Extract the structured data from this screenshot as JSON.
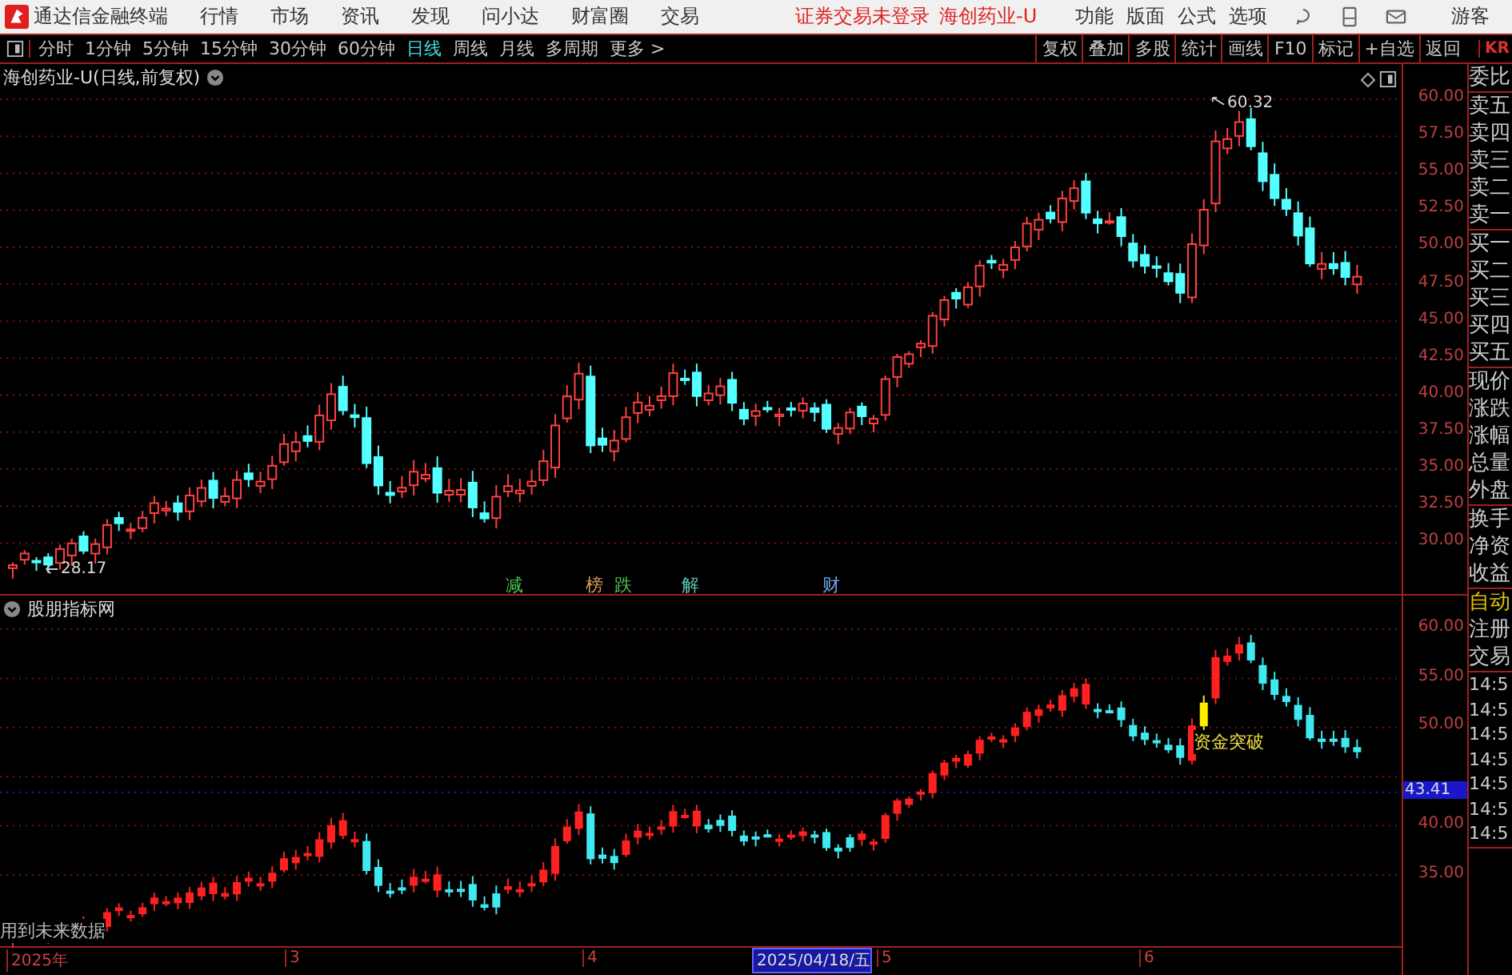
{
  "app": {
    "title": "通达信金融终端",
    "menu": [
      "行情",
      "市场",
      "资讯",
      "发现",
      "问小达",
      "财富圈",
      "交易"
    ],
    "login_status": "证券交易未登录",
    "stock": "海创药业-U",
    "right_menu": [
      "功能",
      "版面",
      "公式",
      "选项"
    ],
    "user": "游客"
  },
  "periods": [
    {
      "label": "分时",
      "selected": false
    },
    {
      "label": "1分钟",
      "selected": false
    },
    {
      "label": "5分钟",
      "selected": false
    },
    {
      "label": "15分钟",
      "selected": false
    },
    {
      "label": "30分钟",
      "selected": false
    },
    {
      "label": "60分钟",
      "selected": false
    },
    {
      "label": "日线",
      "selected": true
    },
    {
      "label": "周线",
      "selected": false
    },
    {
      "label": "月线",
      "selected": false
    },
    {
      "label": "多周期",
      "selected": false
    },
    {
      "label": "更多 >",
      "selected": false
    }
  ],
  "toolbar": [
    "复权",
    "叠加",
    "多股",
    "统计",
    "画线",
    "F10",
    "标记",
    "+自选",
    "返回"
  ],
  "toolbar_cut": "KR",
  "main_chart": {
    "title": "海创药业-U(日线,前复权)",
    "yticks": [
      "60.00",
      "57.50",
      "55.00",
      "52.50",
      "50.00",
      "47.50",
      "45.00",
      "42.50",
      "40.00",
      "37.50",
      "35.00",
      "32.50",
      "30.00"
    ],
    "high_label": "60.32",
    "low_label": "28.17",
    "events": [
      {
        "label": "减",
        "color": "#4cc24c"
      },
      {
        "label": "榜",
        "color": "#d89a5a"
      },
      {
        "label": "跌",
        "color": "#4cc24c"
      },
      {
        "label": "解",
        "color": "#5ac8b0"
      },
      {
        "label": "财",
        "color": "#6aa8e8"
      }
    ]
  },
  "indicator": {
    "title": "股朋指标网",
    "yticks": [
      "60.00",
      "55.00",
      "50.00",
      "40.00",
      "35.00"
    ],
    "current": "43.41",
    "signal": "资金突破",
    "note": "用到未来数据"
  },
  "time_axis": [
    {
      "label": "2025年",
      "selected": false
    },
    {
      "label": "3",
      "selected": false
    },
    {
      "label": "4",
      "selected": false
    },
    {
      "label": "2025/04/18/五",
      "selected": true
    },
    {
      "label": "5",
      "selected": false
    },
    {
      "label": "6",
      "selected": false
    }
  ],
  "side_panel": {
    "quote_groups": [
      [
        "委比"
      ],
      [
        "卖五",
        "卖四",
        "卖三",
        "卖二",
        "卖一"
      ],
      [
        "买一",
        "买二",
        "买三",
        "买四",
        "买五"
      ],
      [
        "现价",
        "涨跌",
        "涨幅",
        "总量",
        "外盘"
      ],
      [
        "换手",
        "净资",
        "收益"
      ]
    ],
    "trade_labels": [
      {
        "label": "自动",
        "kind": "highlight"
      },
      {
        "label": "注册",
        "kind": "plain"
      },
      {
        "label": "交易",
        "kind": "plain"
      }
    ],
    "times": [
      "14:5",
      "14:5",
      "14:5",
      "14:5",
      "14:5",
      "14:5",
      "14:5"
    ]
  }
}
